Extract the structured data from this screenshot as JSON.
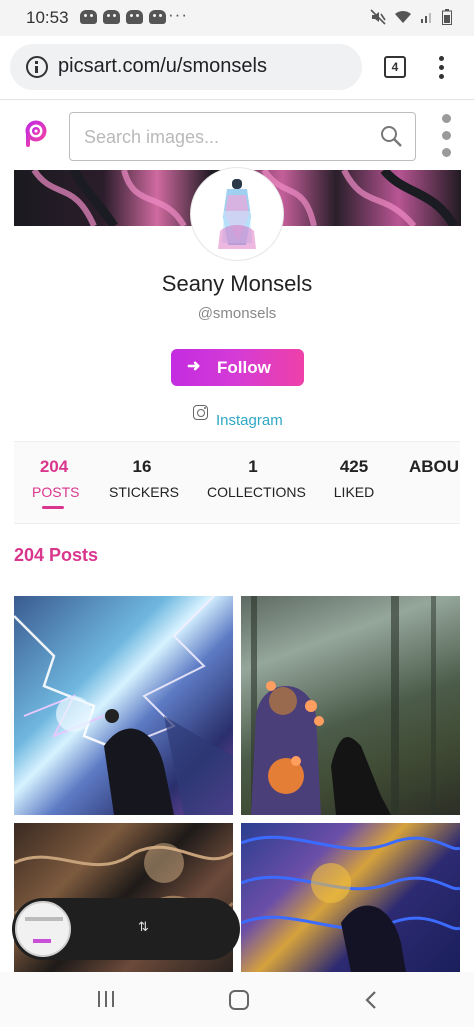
{
  "status_bar": {
    "time": "10:53",
    "overflow": "···"
  },
  "browser": {
    "url": "picsart.com/u/smonsels",
    "tab_count": "4"
  },
  "app": {
    "search_placeholder": "Search images..."
  },
  "profile": {
    "name": "Seany Monsels",
    "handle": "@smonsels",
    "follow_label": "Follow",
    "social_link": "Instagram"
  },
  "stats": [
    {
      "value": "204",
      "label": "POSTS",
      "active": true
    },
    {
      "value": "16",
      "label": "STICKERS"
    },
    {
      "value": "1",
      "label": "COLLECTIONS"
    },
    {
      "value": "425",
      "label": "LIKED"
    },
    {
      "value": "",
      "label": "ABOU"
    }
  ],
  "posts_heading": "204 Posts",
  "colors": {
    "accent": "#d9368e",
    "follow_gradient_start": "#c32ce0",
    "follow_gradient_end": "#ee40a8",
    "link": "#2fa7c5"
  }
}
